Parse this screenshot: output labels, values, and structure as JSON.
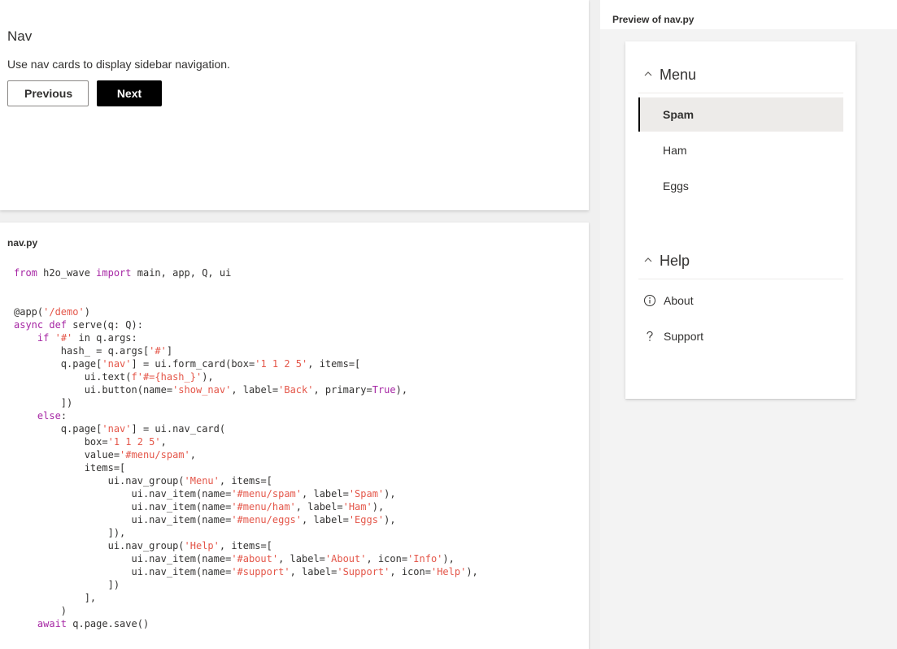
{
  "intro": {
    "title": "Nav",
    "description": "Use nav cards to display sidebar navigation.",
    "previous_label": "Previous",
    "next_label": "Next"
  },
  "code": {
    "filename": "nav.py"
  },
  "preview": {
    "label": "Preview of nav.py",
    "value": "#menu/spam",
    "groups": [
      {
        "label": "Menu",
        "items": [
          {
            "name": "#menu/spam",
            "label": "Spam",
            "selected": true
          },
          {
            "name": "#menu/ham",
            "label": "Ham"
          },
          {
            "name": "#menu/eggs",
            "label": "Eggs"
          }
        ]
      },
      {
        "label": "Help",
        "items": [
          {
            "name": "#about",
            "label": "About",
            "icon": "info-icon"
          },
          {
            "name": "#support",
            "label": "Support",
            "icon": "help-icon"
          }
        ]
      }
    ]
  },
  "colors": {
    "primary_button": "#000000",
    "selected_item_bg": "#edebe9",
    "code_keyword": "#a626a4",
    "code_string": "#e45649"
  }
}
